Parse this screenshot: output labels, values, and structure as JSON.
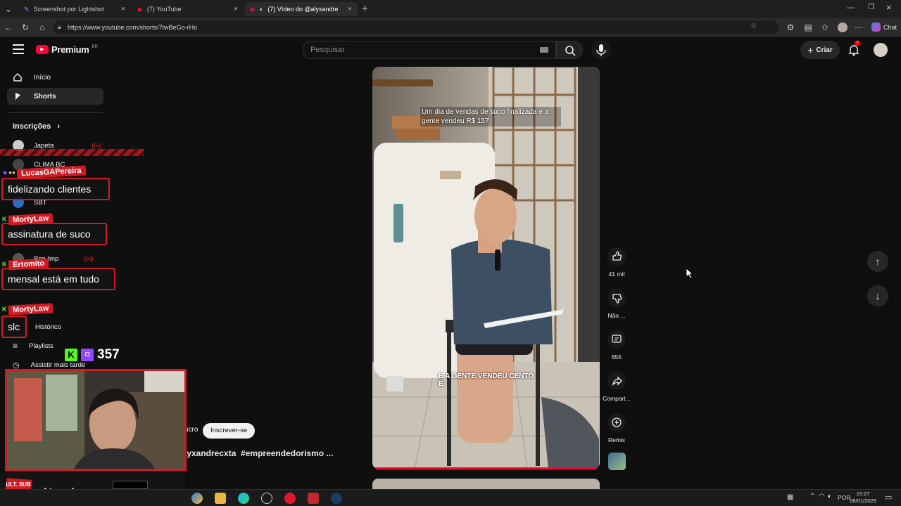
{
  "browser": {
    "tabs": [
      {
        "label": "Screenshot por Lightshot"
      },
      {
        "label": "(7) YouTube"
      },
      {
        "label": "(7) Vídeo do @alyxandrecxta"
      }
    ],
    "url": "https://www.youtube.com/shorts/7twBeGo-rHo",
    "chat_label": "Chat"
  },
  "youtube": {
    "logo": "Premium",
    "logo_region": "BR",
    "search_placeholder": "Pesquisar",
    "create_label": "Criar",
    "notif_count": "7",
    "sidebar": {
      "home": "Início",
      "shorts": "Shorts",
      "subs_header": "Inscrições",
      "subs": [
        "Japeta",
        "CLIMA BC",
        "SBT",
        "Ben Imp"
      ],
      "history": "Histórico",
      "playlists": "Playlists",
      "watch_later": "Assistir mais tarde"
    },
    "video": {
      "caption_top": "Um dia de vendas de suco finalizada e a gente vendeu R$ 157",
      "caption_mid": "E A GENTE VENDEU CENTO E",
      "subscribe": "Inscrever-se",
      "channel_text": "ucro",
      "hashtags": "lyxandrecxta  #empreendedorismo ..."
    },
    "actions": {
      "likes": "41 mil",
      "dislike": "Não ...",
      "comments": "655",
      "share": "Compart...",
      "remix": "Remix"
    }
  },
  "stream": {
    "chats": [
      {
        "user": "LucasGAPereira",
        "msg": "fidelizando clientes"
      },
      {
        "user": "MortyLaw",
        "msg": "assinatura de suco"
      },
      {
        "user": "Ertomito",
        "msg": "mensal está em tudo"
      },
      {
        "user": "MortyLaw",
        "msg": "slc"
      }
    ],
    "viewers": "357",
    "streamer": "shinosuk",
    "sub_badge": "ULT. SUB"
  },
  "taskbar": {
    "lang": "POR",
    "time": "15:27",
    "date": "08/01/2026"
  },
  "colors": {
    "accent": "#ff0033",
    "stream_red": "#d11b24",
    "kick_green": "#53fc18",
    "twitch_purple": "#9146ff"
  }
}
